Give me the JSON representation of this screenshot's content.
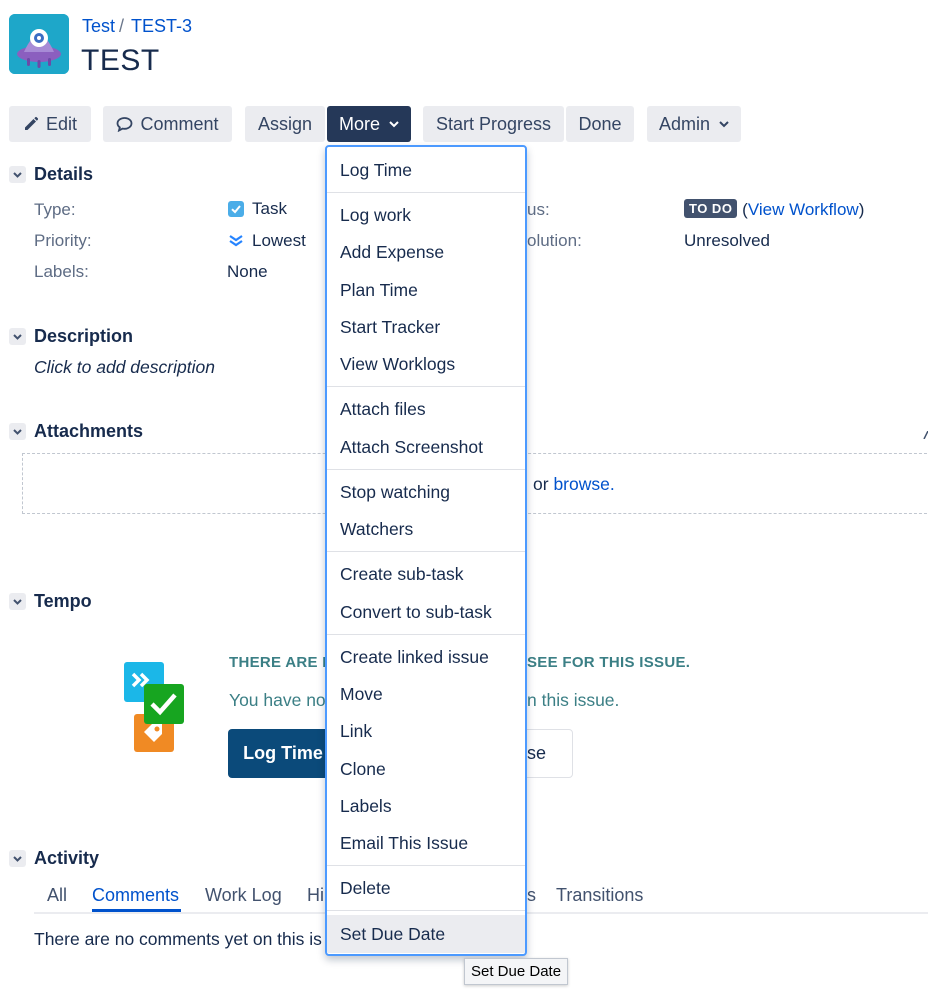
{
  "breadcrumb": {
    "project": "Test",
    "separator": "/",
    "issue_key": "TEST-3"
  },
  "issue": {
    "title": "TEST"
  },
  "toolbar": {
    "edit": "Edit",
    "comment": "Comment",
    "assign": "Assign",
    "more": "More",
    "start_progress": "Start Progress",
    "done": "Done",
    "admin": "Admin"
  },
  "details": {
    "heading": "Details",
    "type_label": "Type:",
    "type_value": "Task",
    "priority_label": "Priority:",
    "priority_value": "Lowest",
    "labels_label": "Labels:",
    "labels_value": "None",
    "status_label_partial": "us:",
    "status_value": "TO DO",
    "workflow_open": "(",
    "workflow_link": "View Workflow",
    "workflow_close": ")",
    "resolution_label_partial": "olution:",
    "resolution_value": "Unresolved"
  },
  "description": {
    "heading": "Description",
    "placeholder": "Click to add description"
  },
  "attachments": {
    "heading": "Attachments",
    "drop_text_partial": "or",
    "browse_link": "browse."
  },
  "tempo": {
    "heading": "Tempo",
    "notice_partial_left": "THERE ARE N",
    "notice_partial_right": "SEE FOR THIS ISSUE.",
    "sub_partial_left": "You have no",
    "sub_partial_right": "n this issue.",
    "log_time_button": "Log Time",
    "expense_button_partial": "ense"
  },
  "activity": {
    "heading": "Activity",
    "tabs": [
      "All",
      "Comments",
      "Work Log",
      "Hi",
      "s",
      "Transitions"
    ],
    "active_tab": "Comments",
    "empty_text_partial": "There are no comments yet on this is"
  },
  "more_menu": {
    "items": [
      "Log Time",
      "Log work",
      "Add Expense",
      "Plan Time",
      "Start Tracker",
      "View Worklogs",
      "Attach files",
      "Attach Screenshot",
      "Stop watching",
      "Watchers",
      "Create sub-task",
      "Convert to sub-task",
      "Create linked issue",
      "Move",
      "Link",
      "Clone",
      "Labels",
      "Email This Issue",
      "Delete",
      "Set Due Date"
    ],
    "hovered": "Set Due Date"
  },
  "tooltip": {
    "text": "Set Due Date"
  },
  "colors": {
    "primary_link": "#0052cc",
    "active_button": "#253858",
    "menu_border": "#4c9aff",
    "tempo_teal": "#3b7f85"
  }
}
